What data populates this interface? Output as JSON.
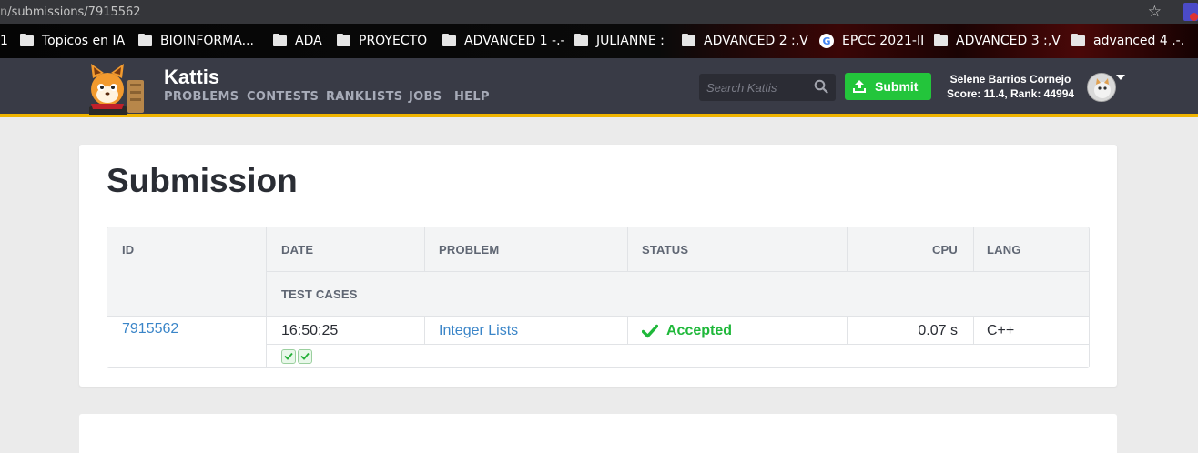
{
  "browser": {
    "url_prefix": "n",
    "url_path": "/submissions/7915562",
    "bookmarks": [
      {
        "label": "1",
        "icon": "none"
      },
      {
        "label": "Topicos en IA",
        "icon": "folder-icon"
      },
      {
        "label": "BIOINFORMA...",
        "icon": "folder-icon"
      },
      {
        "label": "ADA",
        "icon": "folder-icon"
      },
      {
        "label": "PROYECTO",
        "icon": "folder-icon"
      },
      {
        "label": "ADVANCED 1 -.-",
        "icon": "folder-icon"
      },
      {
        "label": "JULIANNE :",
        "icon": "folder-icon"
      },
      {
        "label": "ADVANCED 2 :,V",
        "icon": "folder-icon"
      },
      {
        "label": "EPCC 2021-II",
        "icon": "google-icon"
      },
      {
        "label": "ADVANCED 3 :,V",
        "icon": "folder-icon"
      },
      {
        "label": "advanced 4 .-.",
        "icon": "folder-icon"
      }
    ]
  },
  "header": {
    "brand": "Kattis",
    "nav": [
      "PROBLEMS",
      "CONTESTS",
      "RANKLISTS",
      "JOBS",
      "HELP"
    ],
    "search_placeholder": "Search Kattis",
    "submit_label": "Submit",
    "user_name": "Selene Barrios Cornejo",
    "user_stats": "Score: 11.4, Rank: 44994"
  },
  "page": {
    "title": "Submission",
    "columns": {
      "id": "ID",
      "date": "DATE",
      "problem": "PROBLEM",
      "status": "STATUS",
      "cpu": "CPU",
      "lang": "LANG",
      "test_cases": "TEST CASES"
    },
    "submission": {
      "id": "7915562",
      "date": "16:50:25",
      "problem": "Integer Lists",
      "status": "Accepted",
      "cpu": "0.07 s",
      "lang": "C++",
      "test_cases_passed": 2
    }
  },
  "colors": {
    "header_bg": "#393b46",
    "accent_bar": "#f0b400",
    "submit_green": "#23c53b",
    "accepted_green": "#1fb83a",
    "link_blue": "#3a85c8"
  }
}
